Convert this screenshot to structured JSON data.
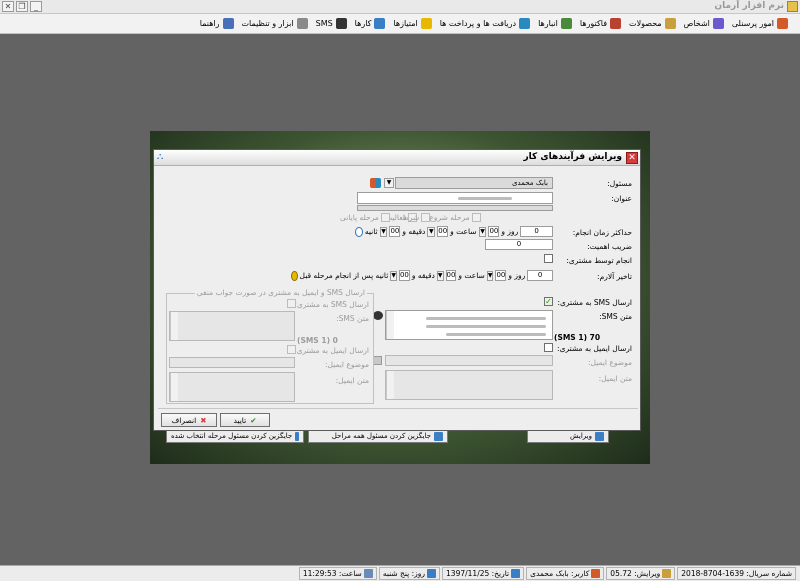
{
  "app": {
    "title": "نرم افزار آرمان"
  },
  "menu": [
    {
      "label": "امور پرسنلی",
      "icon": "personnel-icon",
      "color": "#d35b2a"
    },
    {
      "label": "اشخاص",
      "icon": "people-icon",
      "color": "#6a5acd"
    },
    {
      "label": "محصولات",
      "icon": "products-icon",
      "color": "#c89f3c"
    },
    {
      "label": "فاکتورها",
      "icon": "invoices-icon",
      "color": "#b8412f"
    },
    {
      "label": "انبارها",
      "icon": "warehouse-icon",
      "color": "#4a8a3a"
    },
    {
      "label": "دریافت ها و پرداخت ها",
      "icon": "payments-icon",
      "color": "#2a8ac0"
    },
    {
      "label": "امتیازها",
      "icon": "star-icon",
      "color": "#e6b800"
    },
    {
      "label": "کارها",
      "icon": "tasks-icon",
      "color": "#3a7ec6"
    },
    {
      "label": "SMS",
      "icon": "sms-icon",
      "color": "#333333"
    },
    {
      "label": "ابزار و تنظیمات",
      "icon": "tools-icon",
      "color": "#8a8a8a"
    },
    {
      "label": "راهنما",
      "icon": "help-icon",
      "color": "#4a6fb8"
    }
  ],
  "behind": {
    "edit_button": "ویرایش",
    "replace_all_button": "جایگزین کردن مسئول همه مراحل",
    "replace_selected_button": "جایگزین کردن مسئول مرحله انتخاب شده"
  },
  "dialog": {
    "title": "ویرایش فرآیندهای کار",
    "responsible_label": "مسئول:",
    "responsible_value": "بابک محمدی",
    "subject_label": "عنوان:",
    "stage_start": "مرحله شروع",
    "stage_activity": "فعالیت",
    "stage_condition": "شرط",
    "stage_final": "مرحله پایانی",
    "max_time_label": "حداکثر زمان انجام:",
    "days_value": "0",
    "days_label": "روز و",
    "hours_value": "00",
    "hours_label": "ساعت و",
    "minutes_value": "00",
    "minutes_label": "دقیقه و",
    "seconds_value": "00",
    "seconds_label": "ثانیه",
    "importance_label": "ضریب اهمیت:",
    "importance_value": "0",
    "by_customer_label": "انجام توسط مشتری:",
    "alarm_label": "تاخیر آلارم:",
    "alarm_days_value": "0",
    "alarm_hours_value": "00",
    "alarm_minutes_value": "00",
    "alarm_seconds_value": "00",
    "alarm_seconds_label": "ثانیه پس از انجام مرحله قبل",
    "send_sms_label": "ارسال SMS به مشتری:",
    "sms_text_label": "متن SMS:",
    "sms_count": "70 (1 SMS)",
    "send_email_label": "ارسال ایمیل به مشتری:",
    "email_subject_label": "موضوع ایمیل:",
    "email_text_label": "متن ایمیل:",
    "group_title": "ارسال SMS و ایمیل به مشتری در صورت جواب منفی",
    "neg_send_sms_label": "ارسال SMS به مشتری:",
    "neg_sms_text_label": "متن SMS:",
    "neg_sms_count": "0 (1 SMS)",
    "neg_send_email_label": "ارسال ایمیل به مشتری:",
    "neg_email_subject_label": "موضوع ایمیل:",
    "neg_email_text_label": "متن ایمیل:",
    "ok_button": "تایید",
    "cancel_button": "انصراف"
  },
  "status": {
    "series": "شماره سریال: 1639-8704-2018",
    "version": "ویرایش: 05.72",
    "user": "کاربر: بابک محمدی",
    "date": "تاریخ: 1397/11/25",
    "day": "روز: پنج شنبه",
    "time": "ساعت: 11:29:53"
  }
}
